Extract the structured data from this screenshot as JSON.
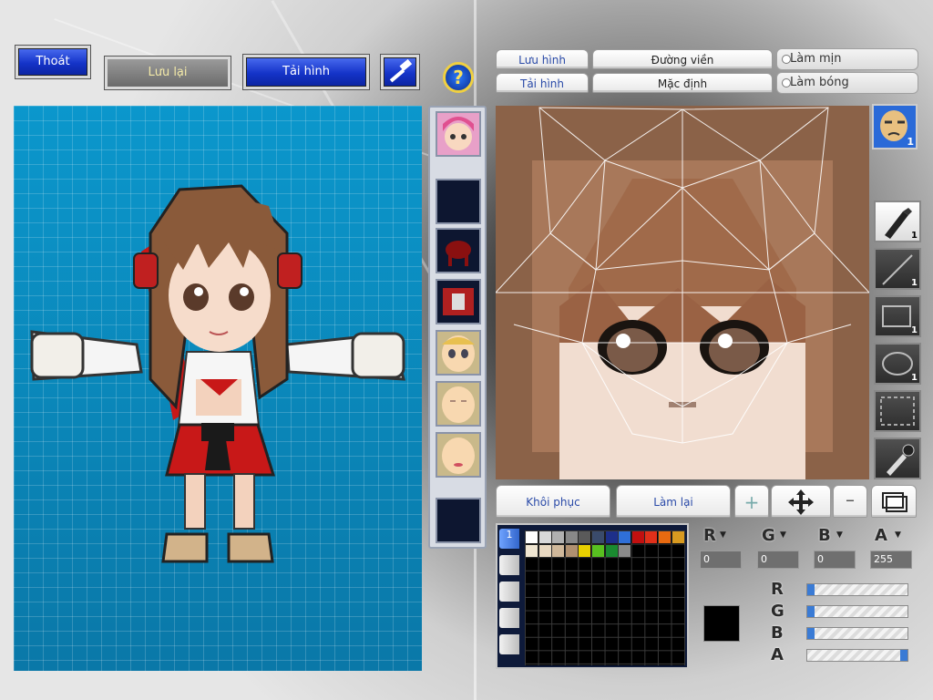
{
  "toolbar": {
    "exit_label": "Thoát",
    "save_label": "Lưu lại",
    "load_label": "Tải hình"
  },
  "editor_toolbar": {
    "save_image": "Lưu hình",
    "load_image": "Tải hình",
    "outline": "Đường viền",
    "default": "Mặc định",
    "smooth": "Làm mịn",
    "shade": "Làm bóng"
  },
  "actions": {
    "restore": "Khôi phục",
    "redo": "Làm lại"
  },
  "tools": [
    {
      "icon": "pen-icon",
      "count": "1"
    },
    {
      "icon": "line-icon",
      "count": "1"
    },
    {
      "icon": "rectangle-icon",
      "count": "1"
    },
    {
      "icon": "ellipse-icon",
      "count": "1"
    },
    {
      "icon": "selection-icon",
      "count": ""
    },
    {
      "icon": "eyedropper-icon",
      "count": ""
    }
  ],
  "head_badge": "1",
  "palette": {
    "tab_active": "1",
    "row1": [
      "#ffffff",
      "#d8d8d8",
      "#b0b0b0",
      "#888888",
      "#5a5a5a",
      "#3a4b6b",
      "#1d2f8a",
      "#2f6fd8",
      "#c21010",
      "#e0301a",
      "#e86a10",
      "#d89a20"
    ],
    "row2": [
      "#f0e6d2",
      "#e8d8c0",
      "#d0b89a",
      "#b09070",
      "#e8d000",
      "#58c020",
      "#1a8a30",
      "#8a8a8a"
    ]
  },
  "color": {
    "labels": {
      "r": "R",
      "g": "G",
      "b": "B",
      "a": "A"
    },
    "r": "0",
    "g": "0",
    "b": "0",
    "a": "255",
    "current": "#000000"
  },
  "colors": {
    "preview_bg": "#0a86b8",
    "skin": "#f6d9c4",
    "hair": "#8a5a3a",
    "dress_red": "#c81818"
  }
}
